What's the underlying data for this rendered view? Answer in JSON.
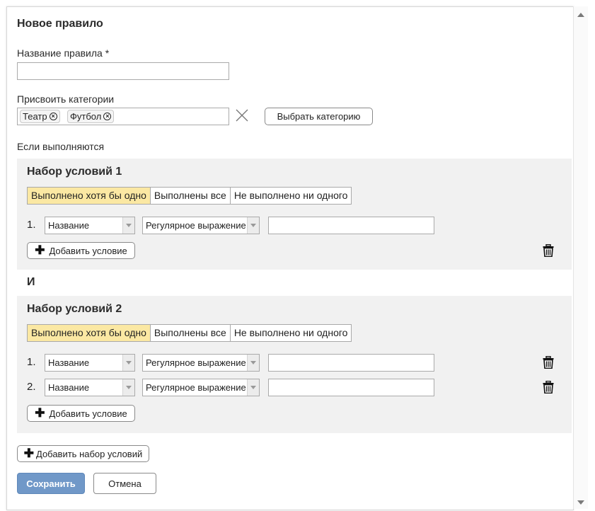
{
  "dialog": {
    "title": "Новое правило",
    "rule_name_label": "Название правила *",
    "rule_name_value": "",
    "categories_label": "Присвоить категории",
    "tags": [
      "Театр",
      "Футбол"
    ],
    "choose_category_label": "Выбрать категорию",
    "if_label": "Если выполняются",
    "and_label": "И",
    "add_set_label": "Добавить набор условий",
    "save_label": "Сохранить",
    "cancel_label": "Отмена"
  },
  "match_modes": [
    "Выполнено хотя бы одно",
    "Выполнены все",
    "Не выполнено ни одного"
  ],
  "sets": [
    {
      "title": "Набор условий 1",
      "active_mode": "Выполнено хотя бы одно",
      "conditions": [
        {
          "num": "1.",
          "field": "Название",
          "operator": "Регулярное выражение",
          "value": ""
        }
      ],
      "add_condition_label": "Добавить условие"
    },
    {
      "title": "Набор условий 2",
      "active_mode": "Выполнено хотя бы одно",
      "conditions": [
        {
          "num": "1.",
          "field": "Название",
          "operator": "Регулярное выражение",
          "value": ""
        },
        {
          "num": "2.",
          "field": "Название",
          "operator": "Регулярное выражение",
          "value": ""
        }
      ],
      "add_condition_label": "Добавить условие"
    }
  ],
  "colors": {
    "active_segment": "#fbe8a3",
    "save_button": "#7098c8",
    "set_background": "#f1f1f1"
  },
  "icons": [
    "close-icon",
    "remove-tag-icon",
    "plus-icon",
    "trash-icon",
    "dropdown-arrow-icon",
    "scroll-up-icon",
    "scroll-down-icon"
  ]
}
